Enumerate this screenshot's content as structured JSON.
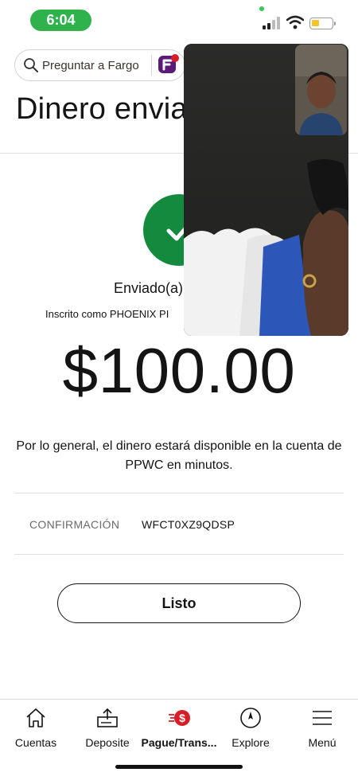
{
  "status_bar": {
    "time": "6:04"
  },
  "header": {
    "search_placeholder": "Preguntar a Fargo",
    "search_icon": "search-icon",
    "assistant_icon": "fargo-icon",
    "title": "Dinero envia"
  },
  "confirmation": {
    "status_icon": "checkmark-icon",
    "status_color": "#138a3e",
    "sent_label": "Enviado(a)",
    "enrolled_text": "Inscrito como PHOENIX PI",
    "amount": "$100.00",
    "notice": "Por lo general, el dinero estará disponible en la cuenta de PPWC en minutos.",
    "confirmation_label": "CONFIRMACIÓN",
    "confirmation_code": "WFCT0XZ9QDSP",
    "done_button": "Listo"
  },
  "bottom_nav": {
    "items": [
      {
        "label": "Cuentas",
        "icon": "home-icon"
      },
      {
        "label": "Deposite",
        "icon": "deposit-icon"
      },
      {
        "label": "Pague/Trans...",
        "icon": "pay-transfer-icon",
        "active": true
      },
      {
        "label": "Explore",
        "icon": "compass-icon"
      },
      {
        "label": "Menú",
        "icon": "hamburger-menu-icon"
      }
    ],
    "accent_color": "#d71e28"
  }
}
